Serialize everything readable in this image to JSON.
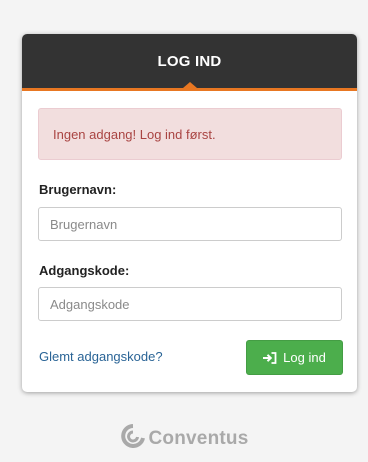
{
  "login": {
    "header_title": "LOG IND",
    "alert_message": "Ingen adgang! Log ind først.",
    "username_label": "Brugernavn:",
    "username_placeholder": "Brugernavn",
    "username_value": "",
    "password_label": "Adgangskode:",
    "password_placeholder": "Adgangskode",
    "password_value": "",
    "forgot_link": "Glemt adgangskode?",
    "submit_label": "Log ind",
    "submit_icon": "sign-in-icon"
  },
  "brand": {
    "name": "Conventus",
    "logo_icon": "conventus-logo-icon"
  },
  "colors": {
    "header_bg": "#333333",
    "accent": "#e87722",
    "alert_bg": "#f2dede",
    "alert_text": "#a94442",
    "button_bg": "#4cae4c",
    "link": "#2a6496"
  }
}
